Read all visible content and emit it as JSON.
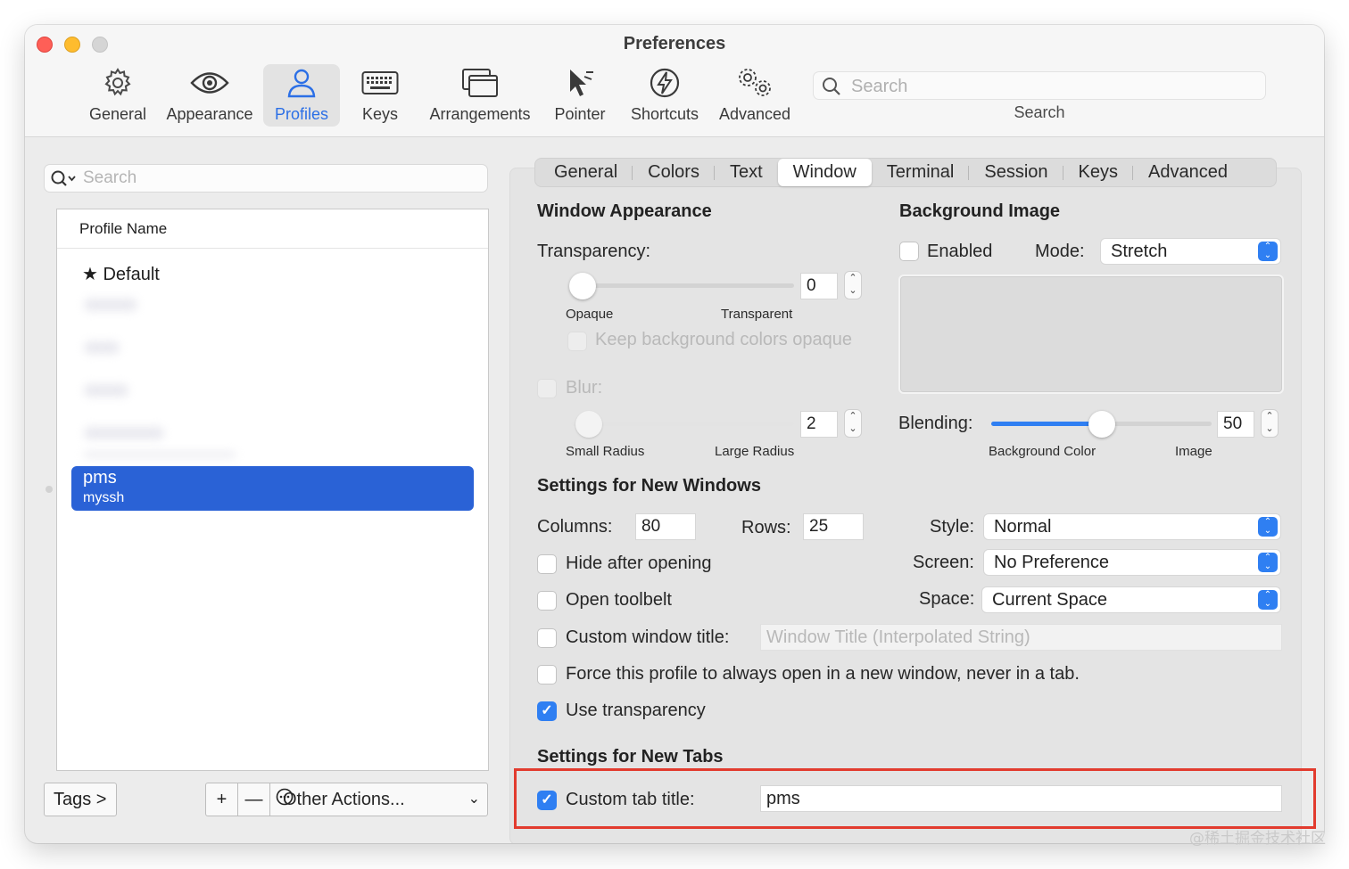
{
  "window": {
    "title": "Preferences"
  },
  "toolbar": {
    "items": [
      {
        "label": "General",
        "icon": "gear-icon"
      },
      {
        "label": "Appearance",
        "icon": "eye-icon"
      },
      {
        "label": "Profiles",
        "icon": "person-icon"
      },
      {
        "label": "Keys",
        "icon": "keyboard-icon"
      },
      {
        "label": "Arrangements",
        "icon": "windows-icon"
      },
      {
        "label": "Pointer",
        "icon": "pointer-icon"
      },
      {
        "label": "Shortcuts",
        "icon": "bolt-icon"
      },
      {
        "label": "Advanced",
        "icon": "gears-icon"
      }
    ],
    "active": "Profiles",
    "search_placeholder": "Search",
    "search_label": "Search"
  },
  "profiles": {
    "search_placeholder": "Search",
    "column_header": "Profile Name",
    "default_item": "★ Default",
    "selected": {
      "name": "pms",
      "tag": "myssh"
    }
  },
  "bottom_bar": {
    "tags_label": "Tags >",
    "add_label": "+",
    "remove_label": "—",
    "other_actions_label": "Other Actions...",
    "other_actions_chevron": "⌄"
  },
  "tabs": {
    "items": [
      "General",
      "Colors",
      "Text",
      "Window",
      "Terminal",
      "Session",
      "Keys",
      "Advanced"
    ],
    "active": "Window"
  },
  "window_appearance": {
    "heading": "Window Appearance",
    "transparency_label": "Transparency:",
    "transparency_value": "0",
    "transparency_fraction": 0.0,
    "opaque_label": "Opaque",
    "transparent_label": "Transparent",
    "keep_bg_label": "Keep background colors opaque",
    "blur_label": "Blur:",
    "blur_value": "2",
    "blur_fraction": 0.05,
    "small_radius_label": "Small Radius",
    "large_radius_label": "Large Radius"
  },
  "background_image": {
    "heading": "Background Image",
    "enabled_label": "Enabled",
    "enabled": false,
    "mode_label": "Mode:",
    "mode_value": "Stretch",
    "blending_label": "Blending:",
    "blending_value": "50",
    "blending_fraction": 0.5,
    "bg_color_label": "Background Color",
    "image_label": "Image"
  },
  "new_windows": {
    "heading": "Settings for New Windows",
    "columns_label": "Columns:",
    "columns_value": "80",
    "rows_label": "Rows:",
    "rows_value": "25",
    "style_label": "Style:",
    "style_value": "Normal",
    "screen_label": "Screen:",
    "screen_value": "No Preference",
    "space_label": "Space:",
    "space_value": "Current Space",
    "hide_after_opening": "Hide after opening",
    "open_toolbelt": "Open toolbelt",
    "custom_window_title": "Custom window title:",
    "window_title_placeholder": "Window Title (Interpolated String)",
    "force_new_window": "Force this profile to always open in a new window, never in a tab.",
    "use_transparency": "Use transparency"
  },
  "new_tabs": {
    "heading": "Settings for New Tabs",
    "custom_tab_title_label": "Custom tab title:",
    "custom_tab_title_value": "pms"
  },
  "watermark": "@稀土掘金技术社区",
  "colors": {
    "accent": "#2f7ff2",
    "selection": "#2a62d6",
    "highlight_box": "#e23b2e"
  }
}
